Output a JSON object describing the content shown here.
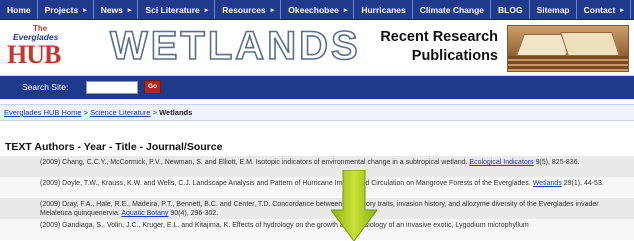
{
  "nav": {
    "items": [
      {
        "label": "Home",
        "arrow": ""
      },
      {
        "label": "Projects",
        "arrow": "▸"
      },
      {
        "label": "News",
        "arrow": "▸"
      },
      {
        "label": "Sci Literature",
        "arrow": "▸"
      },
      {
        "label": "Resources",
        "arrow": "▸"
      },
      {
        "label": "Okeechobee",
        "arrow": "▸"
      },
      {
        "label": "Hurricanes",
        "arrow": ""
      },
      {
        "label": "Climate Change",
        "arrow": ""
      },
      {
        "label": "BLOG",
        "arrow": ""
      },
      {
        "label": "Sitemap",
        "arrow": ""
      },
      {
        "label": "Contact",
        "arrow": "▸"
      }
    ]
  },
  "header": {
    "logo_the": "The",
    "logo_everglades": "Everglades",
    "logo_hub": "HUB",
    "section_title": "WETLANDS",
    "subtitle_line1": "Recent Research",
    "subtitle_line2": "Publications"
  },
  "search": {
    "label": "Search Site:",
    "value": "",
    "go_label": "Go"
  },
  "breadcrumb": {
    "home": "Everglades HUB Home",
    "sep1": " > ",
    "parent": "Science Literature",
    "sep2": " > ",
    "current": "Wetlands"
  },
  "content": {
    "heading": "TEXT Authors - Year - Title - Journal/Source",
    "refs": [
      {
        "text": "(2009) Chang, C.C.Y., McCormick, P.V., Newman, S. and Elliott, E.M. Isotopic indicators of environmental change in a subtropical wetland. ",
        "journal": "Ecological Indicators",
        "tail": " 9(5), 825-836."
      },
      {
        "text": "(2009) Doyle, T.W., Krauss, K.W. and Wells, C.J. Landscape Analysis and Pattern of Hurricane Impact and Circulation on Mangrove Forests of the Everglades. ",
        "journal": "Wetlands",
        "tail": " 29(1), 44-53."
      },
      {
        "text": "(2009) Dray, F.A., Hale, R.E., Madeira, P.T., Bennett, B.C. and Center, T.D. Concordance between life history traits, invasion history, and allozyme diversity of the Everglades invader Melaleuca quinquenervia. ",
        "journal": "Aquatic Botany",
        "tail": " 90(4), 296-302."
      },
      {
        "text": "(2009) Gandiaga, S., Volin, J.C., Kruger, E.L. and Kitajima, K. Effects of hydrology on the growth and physiology of an invasive exotic, Lygodium microphyllum",
        "journal": "",
        "tail": ""
      }
    ]
  },
  "colors": {
    "nav_bg": "#1f3a8a",
    "accent_red": "#c0392b",
    "arrow_green": "#a6c61a"
  },
  "icons": {
    "nav_arrow": "chevron-right-icon",
    "overlay": "down-arrow-icon"
  }
}
